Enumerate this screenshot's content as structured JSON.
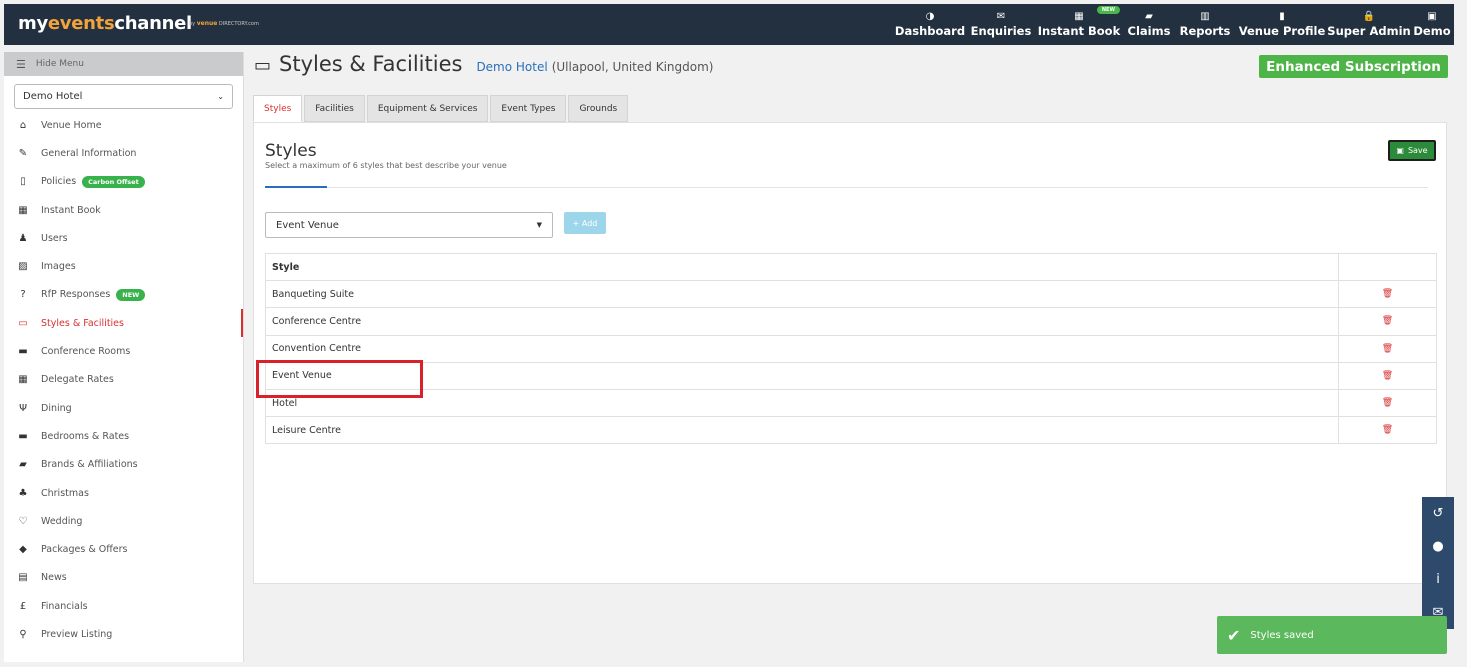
{
  "brand": {
    "prefix": "my",
    "accent": "events",
    "suffix": "channel",
    "by": "by",
    "sub_accent": "venue",
    "sub_main": "DIRECTORY.com"
  },
  "nav": [
    {
      "icon": "dashboard-icon",
      "glyph": "◑",
      "label": "Dashboard"
    },
    {
      "icon": "envelope-icon",
      "glyph": "✉",
      "label": "Enquiries"
    },
    {
      "icon": "calendar-icon",
      "glyph": "▦",
      "label": "Instant Book",
      "badge": "NEW"
    },
    {
      "icon": "book-icon",
      "glyph": "▰",
      "label": "Claims"
    },
    {
      "icon": "bar-chart-icon",
      "glyph": "▥",
      "label": "Reports"
    },
    {
      "icon": "building-icon",
      "glyph": "▮",
      "label": "Venue Profile"
    },
    {
      "icon": "lock-icon",
      "glyph": "🔒",
      "label": "Super Admin"
    },
    {
      "icon": "user-icon",
      "glyph": "▣",
      "label": "Demo"
    }
  ],
  "sidebar": {
    "hide_label": "Hide Menu",
    "venue_select": "Demo Hotel",
    "items": [
      {
        "label": "Venue Home",
        "icon": "home-icon",
        "glyph": "⌂"
      },
      {
        "label": "General Information",
        "icon": "edit-icon",
        "glyph": "✎"
      },
      {
        "label": "Policies",
        "icon": "file-icon",
        "glyph": "▯",
        "pill": "Carbon Offset"
      },
      {
        "label": "Instant Book",
        "icon": "calendar-icon",
        "glyph": "▦"
      },
      {
        "label": "Users",
        "icon": "user-icon",
        "glyph": "♟"
      },
      {
        "label": "Images",
        "icon": "image-icon",
        "glyph": "▨"
      },
      {
        "label": "RfP Responses",
        "icon": "question-icon",
        "glyph": "?",
        "pill": "NEW"
      },
      {
        "label": "Styles & Facilities",
        "icon": "monitor-icon",
        "glyph": "▭",
        "active": true
      },
      {
        "label": "Conference Rooms",
        "icon": "briefcase-icon",
        "glyph": "▬"
      },
      {
        "label": "Delegate Rates",
        "icon": "calculator-icon",
        "glyph": "▦"
      },
      {
        "label": "Dining",
        "icon": "cutlery-icon",
        "glyph": "Ψ"
      },
      {
        "label": "Bedrooms & Rates",
        "icon": "bed-icon",
        "glyph": "▬"
      },
      {
        "label": "Brands & Affiliations",
        "icon": "book-icon",
        "glyph": "▰"
      },
      {
        "label": "Christmas",
        "icon": "tree-icon",
        "glyph": "♣"
      },
      {
        "label": "Wedding",
        "icon": "heart-icon",
        "glyph": "♡"
      },
      {
        "label": "Packages & Offers",
        "icon": "tag-icon",
        "glyph": "◆"
      },
      {
        "label": "News",
        "icon": "newspaper-icon",
        "glyph": "▤"
      },
      {
        "label": "Financials",
        "icon": "pound-icon",
        "glyph": "£"
      },
      {
        "label": "Preview Listing",
        "icon": "search-icon",
        "glyph": "⚲"
      }
    ]
  },
  "header": {
    "title": "Styles & Facilities",
    "hotel": "Demo Hotel",
    "location": "(Ullapool, United Kingdom)",
    "subscription": "Enhanced Subscription"
  },
  "tabs": [
    "Styles",
    "Facilities",
    "Equipment & Services",
    "Event Types",
    "Grounds"
  ],
  "panel": {
    "heading": "Styles",
    "subtitle": "Select a maximum of 6 styles that best describe your venue",
    "save_label": "Save",
    "select_value": "Event Venue",
    "add_label": "+ Add",
    "table_header": "Style",
    "rows": [
      "Banqueting Suite",
      "Conference Centre",
      "Convention Centre",
      "Event Venue",
      "Hotel",
      "Leisure Centre"
    ]
  },
  "toast": "Styles saved",
  "colors": {
    "topbar": "#22303f",
    "accent": "#d9302f",
    "green": "#4db548",
    "link": "#2a6ebb"
  }
}
